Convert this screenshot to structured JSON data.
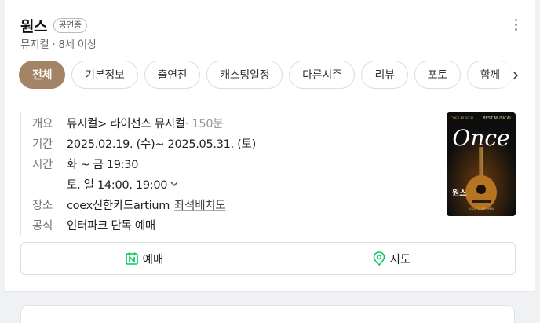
{
  "header": {
    "title": "원스",
    "status_badge": "공연중",
    "subtitle": "뮤지컬 · 8세 이상"
  },
  "tabs": [
    {
      "label": "전체",
      "active": true
    },
    {
      "label": "기본정보"
    },
    {
      "label": "출연진"
    },
    {
      "label": "캐스팅일정"
    },
    {
      "label": "다른시즌"
    },
    {
      "label": "리뷰"
    },
    {
      "label": "포토"
    },
    {
      "label": "함께"
    }
  ],
  "info": {
    "overview_label": "개요",
    "overview_genre": "뮤지컬> 라이선스 뮤지컬",
    "overview_runtime": " · 150분",
    "period_label": "기간",
    "period_value": "2025.02.19. (수)~ 2025.05.31. (토)",
    "time_label": "시간",
    "time_weekday": "화 ~ 금 19:30",
    "time_weekend": "토, 일 14:00, 19:00",
    "venue_label": "장소",
    "venue_value": "coex신한카드artium",
    "seat_map_link": "좌석배치도",
    "official_label": "공식",
    "official_value": "인터파크 단독 예매"
  },
  "poster": {
    "top_left": "COEX MUSICAL",
    "top_right": "BEST MUSICAL",
    "logo": "Once",
    "korean_title": "원스",
    "bottom_text": "2025. 2. 19 OPEN"
  },
  "actions": {
    "book_label": "예매",
    "map_label": "지도"
  },
  "colors": {
    "active_tab": "#a38466",
    "naver_green": "#03c75a"
  }
}
